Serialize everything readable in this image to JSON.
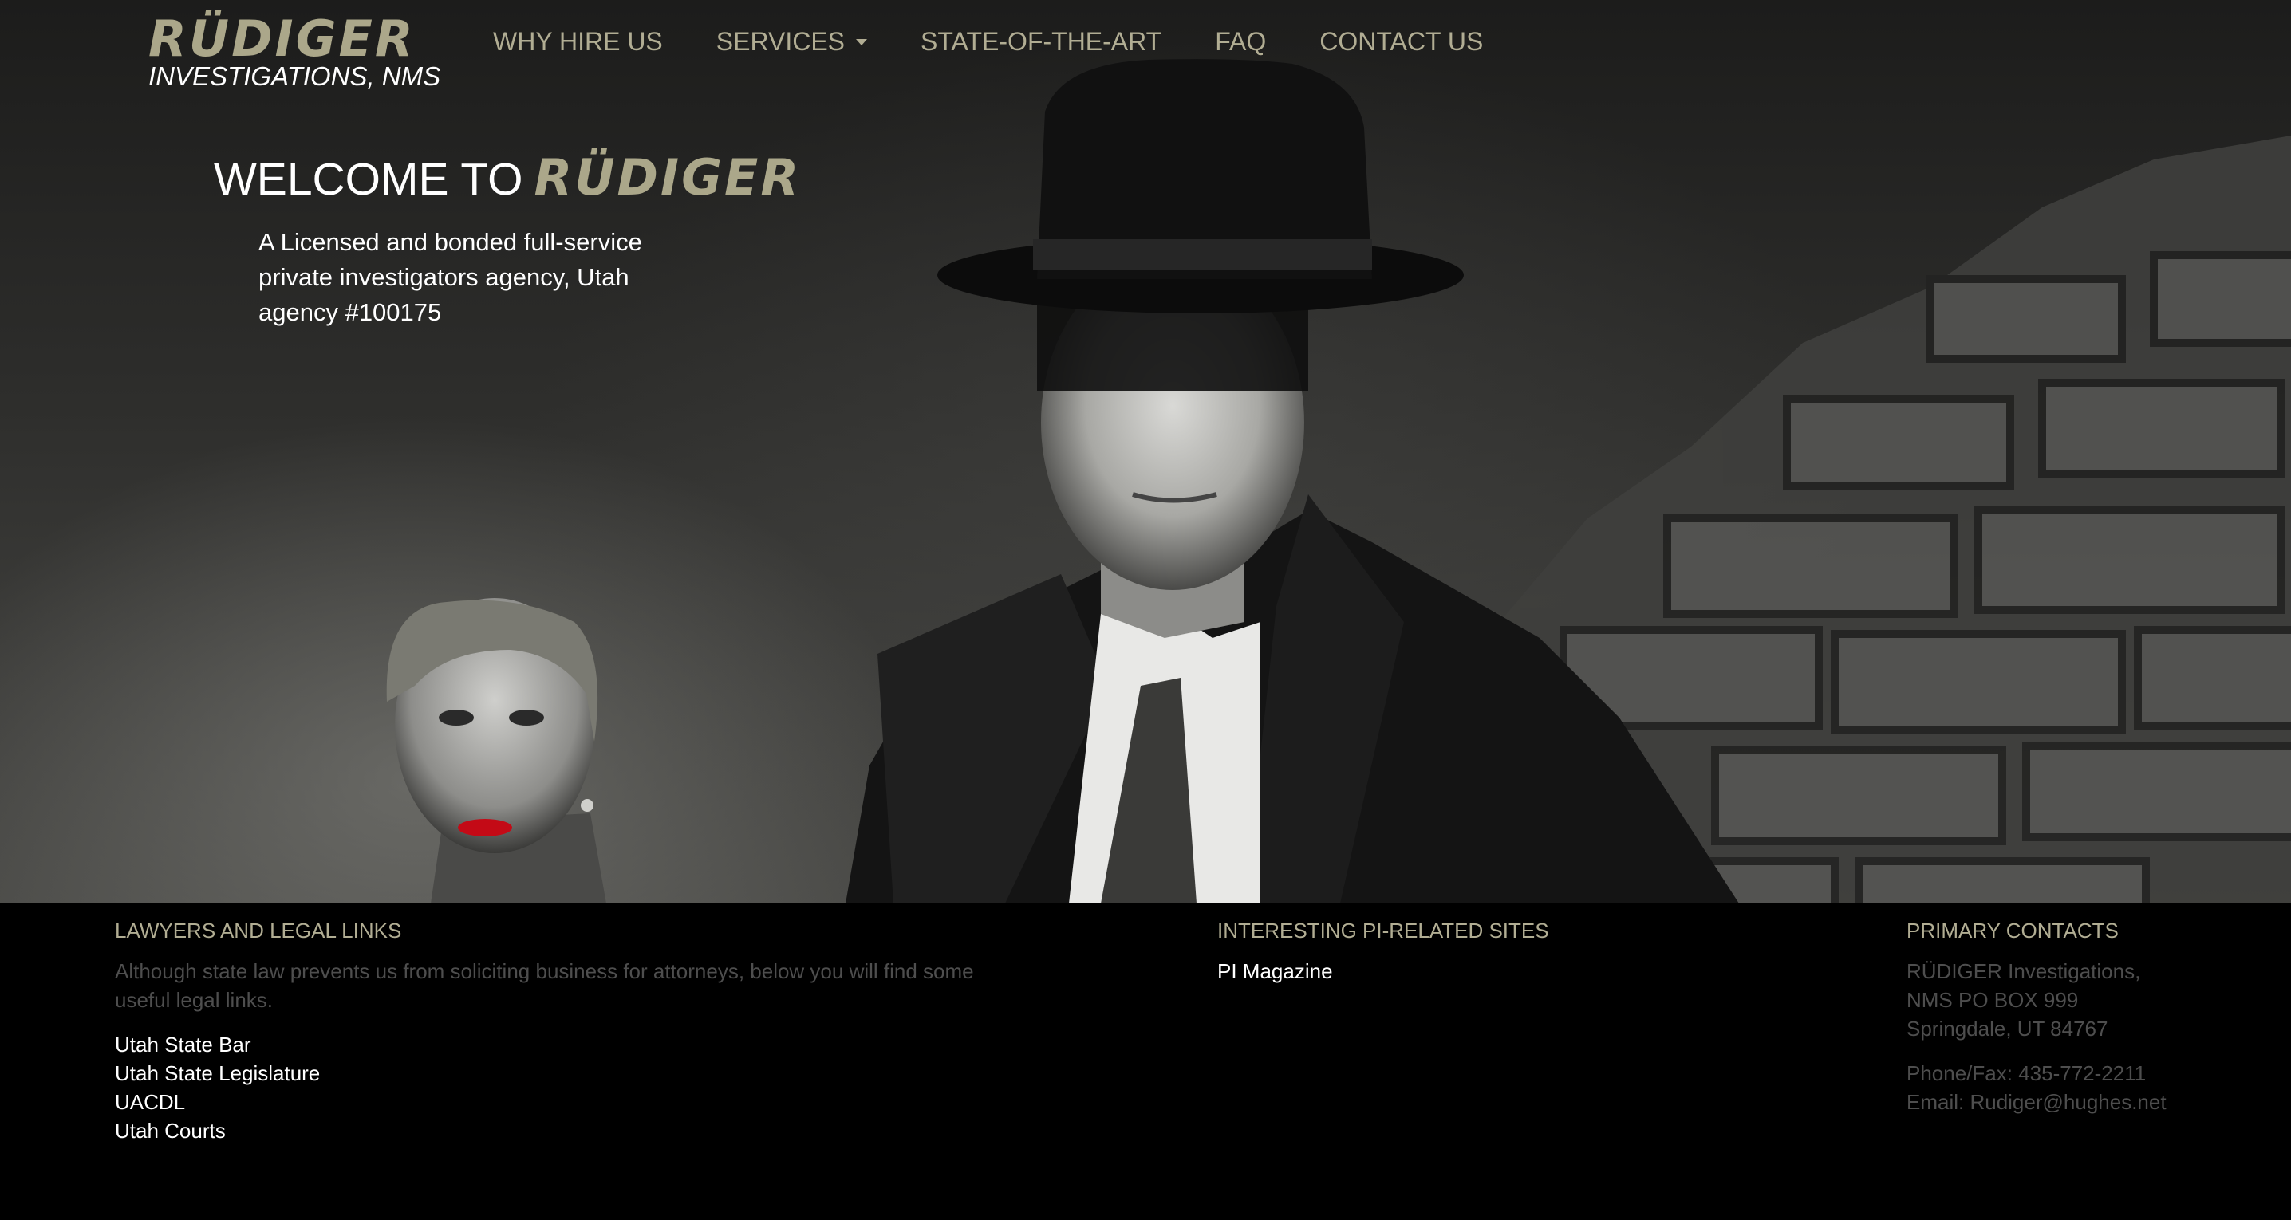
{
  "brand": {
    "name": "RÜDIGER",
    "subtitle": "INVESTIGATIONS, NMS"
  },
  "nav": {
    "items": [
      {
        "label": "WHY HIRE US",
        "has_caret": false
      },
      {
        "label": "SERVICES",
        "has_caret": true
      },
      {
        "label": "STATE-OF-THE-ART",
        "has_caret": false
      },
      {
        "label": "FAQ",
        "has_caret": false
      },
      {
        "label": "CONTACT US",
        "has_caret": false
      }
    ]
  },
  "hero": {
    "welcome_prefix": "WELCOME TO",
    "welcome_brand": "RÜDIGER",
    "tagline": "A Licensed and bonded full-service private investigators agency, Utah agency #100175"
  },
  "footer": {
    "legal": {
      "heading": "LAWYERS AND LEGAL LINKS",
      "intro": "Although state law prevents us from soliciting business for attorneys, below you will find some useful legal links.",
      "links": [
        "Utah State Bar",
        "Utah State Legislature",
        "UACDL",
        "Utah Courts"
      ]
    },
    "pi_sites": {
      "heading": "INTERESTING PI-RELATED SITES",
      "links": [
        "PI Magazine"
      ]
    },
    "contacts": {
      "heading": "PRIMARY CONTACTS",
      "address_line1": "RÜDIGER Investigations,",
      "address_line2": "NMS PO BOX 999",
      "address_line3": "Springdale, UT 84767",
      "phone": "Phone/Fax: 435-772-2211",
      "email": "Email: Rudiger@hughes.net"
    }
  },
  "colors": {
    "accent": "#aba78a",
    "nav_text": "#b1ad93",
    "muted_text": "#4e4e4e",
    "footer_bg": "#000000"
  }
}
